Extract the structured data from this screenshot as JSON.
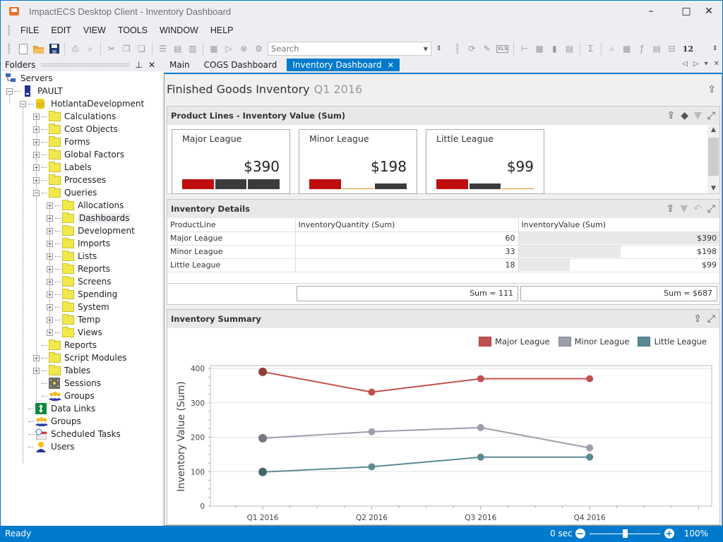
{
  "window": {
    "title": "ImpactECS Desktop Client - Inventory Dashboard",
    "controls": {
      "minimize": "–",
      "maximize": "□",
      "close": "✕"
    }
  },
  "menu": [
    "FILE",
    "EDIT",
    "VIEW",
    "TOOLS",
    "WINDOW",
    "HELP"
  ],
  "toolbar": {
    "search_placeholder": "Search",
    "icons_left": [
      "new-icon",
      "open-folder-icon",
      "save-icon",
      "print-icon",
      "print-preview-icon",
      "cut-icon",
      "copy-icon",
      "paste-icon",
      "add-record-icon",
      "new-document-icon",
      "delete-document-icon",
      "calculator-icon",
      "run-icon",
      "stop-icon",
      "settings-icon"
    ],
    "icons_right": [
      "refresh-icon",
      "edit-icon",
      "xlsx-export-icon",
      "tree-icon",
      "grid-icon",
      "bar-chart-icon",
      "summary-grid-icon",
      "sum-icon",
      "inspect-icon",
      "lock-grid-icon",
      "formula-icon",
      "field-list-icon",
      "fit-width-icon"
    ],
    "font_size_label": "12"
  },
  "folders": {
    "title": "Folders",
    "tree": {
      "servers": "Servers",
      "server": "PAULT",
      "database": "HotlantaDevelopment",
      "db_children": [
        "Calculations",
        "Cost Objects",
        "Forms",
        "Global Factors",
        "Labels",
        "Processes"
      ],
      "queries": "Queries",
      "queries_children": [
        "Allocations",
        "Dashboards",
        "Development",
        "Imports",
        "Lists",
        "Reports",
        "Screens",
        "Spending",
        "System",
        "Temp",
        "Views"
      ],
      "selected": "Dashboards",
      "db_after": [
        "Reports",
        "Script Modules",
        "Tables",
        "Sessions",
        "Groups"
      ],
      "root_after": [
        "Data Links",
        "Groups",
        "Scheduled Tasks",
        "Users"
      ]
    }
  },
  "tabs": [
    {
      "label": "Main",
      "active": false
    },
    {
      "label": "COGS Dashboard",
      "active": false
    },
    {
      "label": "Inventory Dashboard",
      "active": true
    }
  ],
  "dashboard": {
    "title": "Finished Goods Inventory",
    "period": "Q1 2016",
    "product_lines": {
      "title": "Product Lines - Inventory Value (Sum)",
      "cards": [
        {
          "name": "Major League",
          "value": "$390",
          "sparkbars": [
            {
              "color": "#c00d0d",
              "fill": 1.0
            },
            {
              "color": "#3c3c3c",
              "fill": 1.0
            },
            {
              "color": "#3c3c3c",
              "fill": 1.0
            }
          ]
        },
        {
          "name": "Minor League",
          "value": "$198",
          "sparkbars": [
            {
              "color": "#c00d0d",
              "fill": 1.0
            },
            {
              "color": "#e08a1e",
              "fill": 0.08
            },
            {
              "color": "#3c3c3c",
              "fill": 0.6
            }
          ]
        },
        {
          "name": "Little League",
          "value": "$99",
          "sparkbars": [
            {
              "color": "#c00d0d",
              "fill": 1.0
            },
            {
              "color": "#3c3c3c",
              "fill": 0.55
            },
            {
              "color": "#e08a1e",
              "fill": 0.08
            }
          ]
        }
      ]
    },
    "details": {
      "title": "Inventory Details",
      "columns": [
        "ProductLine",
        "InventoryQuantity (Sum)",
        "InventoryValue (Sum)"
      ],
      "rows": [
        {
          "line": "Major League",
          "qty": "60",
          "value": "$390",
          "value_num": 390
        },
        {
          "line": "Minor League",
          "qty": "33",
          "value": "$198",
          "value_num": 198
        },
        {
          "line": "Little League",
          "qty": "18",
          "value": "$99",
          "value_num": 99
        }
      ],
      "totals": {
        "qty": "Sum = 111",
        "value": "Sum = $687"
      }
    },
    "summary": {
      "title": "Inventory Summary"
    }
  },
  "chart_data": {
    "type": "line",
    "title": "Inventory Summary",
    "xlabel": "",
    "ylabel": "Inventory Value (Sum)",
    "categories": [
      "Q1 2016",
      "Q2 2016",
      "Q3 2016",
      "Q4 2016"
    ],
    "ylim": [
      0,
      400
    ],
    "yticks": [
      0,
      100,
      200,
      300,
      400
    ],
    "grid": true,
    "legend": "top-right",
    "series": [
      {
        "name": "Major League",
        "color": "#c0504d",
        "values": [
          390,
          331,
          370,
          370
        ]
      },
      {
        "name": "Minor League",
        "color": "#9c9eab",
        "values": [
          197,
          216,
          228,
          169
        ]
      },
      {
        "name": "Little League",
        "color": "#5a8a93",
        "values": [
          99,
          114,
          142,
          142
        ]
      }
    ]
  },
  "status": {
    "text": "Ready",
    "timer": "0 sec",
    "zoom": "100%",
    "zoom_level": 0.5
  }
}
